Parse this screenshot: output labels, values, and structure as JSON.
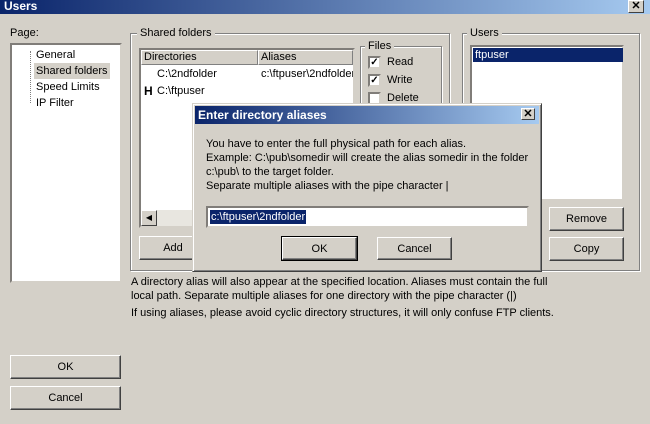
{
  "window": {
    "title": "Users",
    "close_glyph": "✕"
  },
  "page_panel": {
    "label": "Page:",
    "items": [
      "General",
      "Shared folders",
      "Speed Limits",
      "IP Filter"
    ]
  },
  "shared_folders": {
    "label": "Shared folders",
    "columns": [
      "Directories",
      "Aliases"
    ],
    "rows": [
      {
        "marker": "",
        "directory": "C:\\2ndfolder",
        "alias": "c:\\ftpuser\\2ndfolder"
      },
      {
        "marker": "H",
        "directory": "C:\\ftpuser",
        "alias": ""
      }
    ],
    "add_label": "Add",
    "note1": "A directory alias will also appear at the specified location. Aliases must contain the full local path. Separate multiple aliases for one directory with the pipe character (|)",
    "note2": "If using aliases, please avoid cyclic directory structures, it will only confuse FTP clients."
  },
  "files": {
    "label": "Files",
    "options": [
      {
        "label": "Read",
        "checked": true
      },
      {
        "label": "Write",
        "checked": true
      },
      {
        "label": "Delete",
        "checked": false
      }
    ]
  },
  "users": {
    "label": "Users",
    "items": [
      "ftpuser"
    ],
    "remove_label": "Remove",
    "copy_label": "Copy"
  },
  "footer": {
    "ok_label": "OK",
    "cancel_label": "Cancel"
  },
  "alias_dialog": {
    "title": "Enter directory aliases",
    "close_glyph": "✕",
    "line1": "You have to enter the full physical path for each alias.",
    "line2": "Example: C:\\pub\\somedir will create the alias somedir in the folder",
    "line3": "c:\\pub\\ to the target folder.",
    "line4": "Separate multiple aliases with the pipe character |",
    "input_value": "c:\\ftpuser\\2ndfolder",
    "ok_label": "OK",
    "cancel_label": "Cancel"
  },
  "icons": {
    "scroll_left": "◀"
  },
  "colors": {
    "selection": "#0a246a",
    "face": "#d4d0c8"
  }
}
